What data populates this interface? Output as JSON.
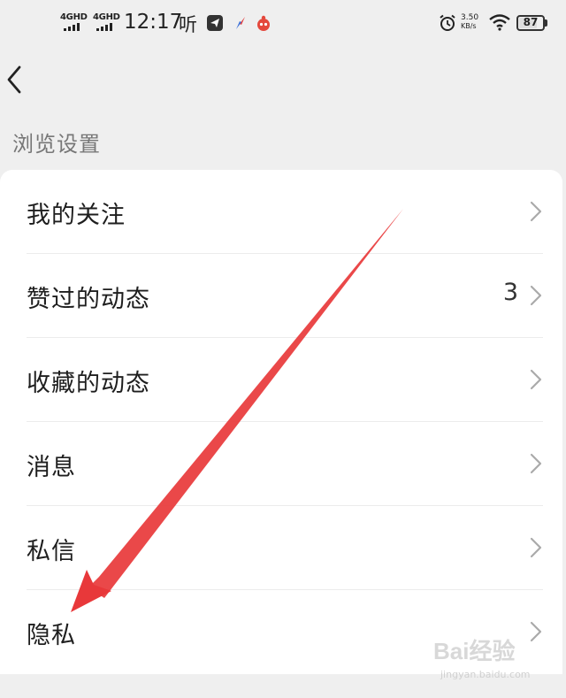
{
  "status_bar": {
    "signal1_label": "4GHD",
    "signal2_label": "4GHD",
    "time": "12:17",
    "listen_glyph": "听",
    "speed_value": "3.50",
    "speed_unit": "KB/s",
    "battery": "87"
  },
  "header": {
    "back_icon": "chevron-left-icon"
  },
  "section_title": "浏览设置",
  "menu": {
    "items": [
      {
        "label": "我的关注",
        "count": ""
      },
      {
        "label": "赞过的动态",
        "count": "3"
      },
      {
        "label": "收藏的动态",
        "count": ""
      },
      {
        "label": "消息",
        "count": ""
      },
      {
        "label": "私信",
        "count": ""
      },
      {
        "label": "隐私",
        "count": ""
      }
    ]
  },
  "annotation": {
    "color": "#e8383a"
  },
  "watermark": {
    "brand": "Bai经验",
    "site": "jingyan.baidu.com"
  }
}
